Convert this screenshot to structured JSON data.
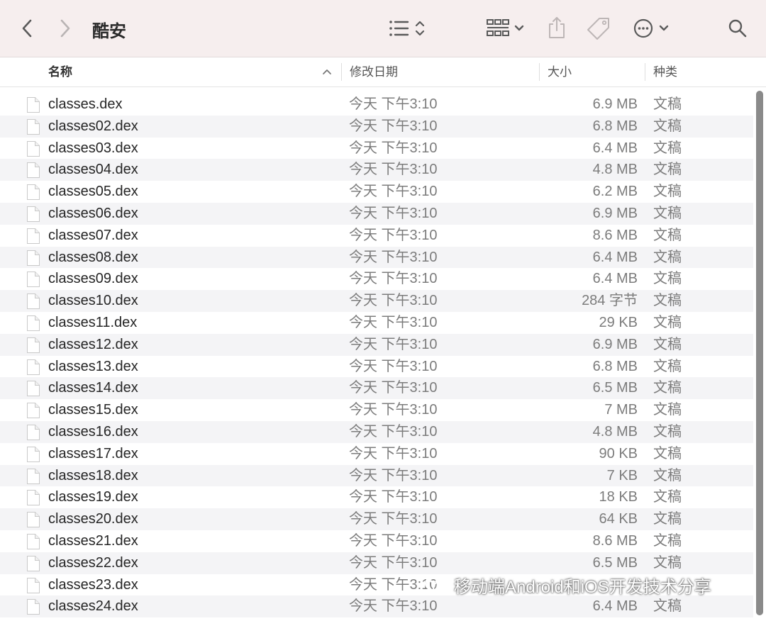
{
  "window": {
    "title": "酷安"
  },
  "columns": {
    "name": "名称",
    "date": "修改日期",
    "size": "大小",
    "kind": "种类"
  },
  "files": [
    {
      "name": "classes.dex",
      "date": "今天 下午3:10",
      "size": "6.9 MB",
      "kind": "文稿"
    },
    {
      "name": "classes02.dex",
      "date": "今天 下午3:10",
      "size": "6.8 MB",
      "kind": "文稿"
    },
    {
      "name": "classes03.dex",
      "date": "今天 下午3:10",
      "size": "6.4 MB",
      "kind": "文稿"
    },
    {
      "name": "classes04.dex",
      "date": "今天 下午3:10",
      "size": "4.8 MB",
      "kind": "文稿"
    },
    {
      "name": "classes05.dex",
      "date": "今天 下午3:10",
      "size": "6.2 MB",
      "kind": "文稿"
    },
    {
      "name": "classes06.dex",
      "date": "今天 下午3:10",
      "size": "6.9 MB",
      "kind": "文稿"
    },
    {
      "name": "classes07.dex",
      "date": "今天 下午3:10",
      "size": "8.6 MB",
      "kind": "文稿"
    },
    {
      "name": "classes08.dex",
      "date": "今天 下午3:10",
      "size": "6.4 MB",
      "kind": "文稿"
    },
    {
      "name": "classes09.dex",
      "date": "今天 下午3:10",
      "size": "6.4 MB",
      "kind": "文稿"
    },
    {
      "name": "classes10.dex",
      "date": "今天 下午3:10",
      "size": "284 字节",
      "kind": "文稿"
    },
    {
      "name": "classes11.dex",
      "date": "今天 下午3:10",
      "size": "29 KB",
      "kind": "文稿"
    },
    {
      "name": "classes12.dex",
      "date": "今天 下午3:10",
      "size": "6.9 MB",
      "kind": "文稿"
    },
    {
      "name": "classes13.dex",
      "date": "今天 下午3:10",
      "size": "6.8 MB",
      "kind": "文稿"
    },
    {
      "name": "classes14.dex",
      "date": "今天 下午3:10",
      "size": "6.5 MB",
      "kind": "文稿"
    },
    {
      "name": "classes15.dex",
      "date": "今天 下午3:10",
      "size": "7 MB",
      "kind": "文稿"
    },
    {
      "name": "classes16.dex",
      "date": "今天 下午3:10",
      "size": "4.8 MB",
      "kind": "文稿"
    },
    {
      "name": "classes17.dex",
      "date": "今天 下午3:10",
      "size": "90 KB",
      "kind": "文稿"
    },
    {
      "name": "classes18.dex",
      "date": "今天 下午3:10",
      "size": "7 KB",
      "kind": "文稿"
    },
    {
      "name": "classes19.dex",
      "date": "今天 下午3:10",
      "size": "18 KB",
      "kind": "文稿"
    },
    {
      "name": "classes20.dex",
      "date": "今天 下午3:10",
      "size": "64 KB",
      "kind": "文稿"
    },
    {
      "name": "classes21.dex",
      "date": "今天 下午3:10",
      "size": "8.6 MB",
      "kind": "文稿"
    },
    {
      "name": "classes22.dex",
      "date": "今天 下午3:10",
      "size": "6.5 MB",
      "kind": "文稿"
    },
    {
      "name": "classes23.dex",
      "date": "今天 下午3:10",
      "size": "",
      "kind": ""
    },
    {
      "name": "classes24.dex",
      "date": "今天 下午3:10",
      "size": "6.4 MB",
      "kind": "文稿"
    }
  ],
  "watermark": {
    "text": "移动端Android和iOS开发技术分享"
  },
  "icons": {
    "back": "chevron-left-icon",
    "forward": "chevron-right-icon",
    "list_view": "list-view-icon",
    "grid_view": "grid-view-icon",
    "share": "share-icon",
    "tag": "tag-icon",
    "more": "more-icon",
    "search": "search-icon"
  }
}
